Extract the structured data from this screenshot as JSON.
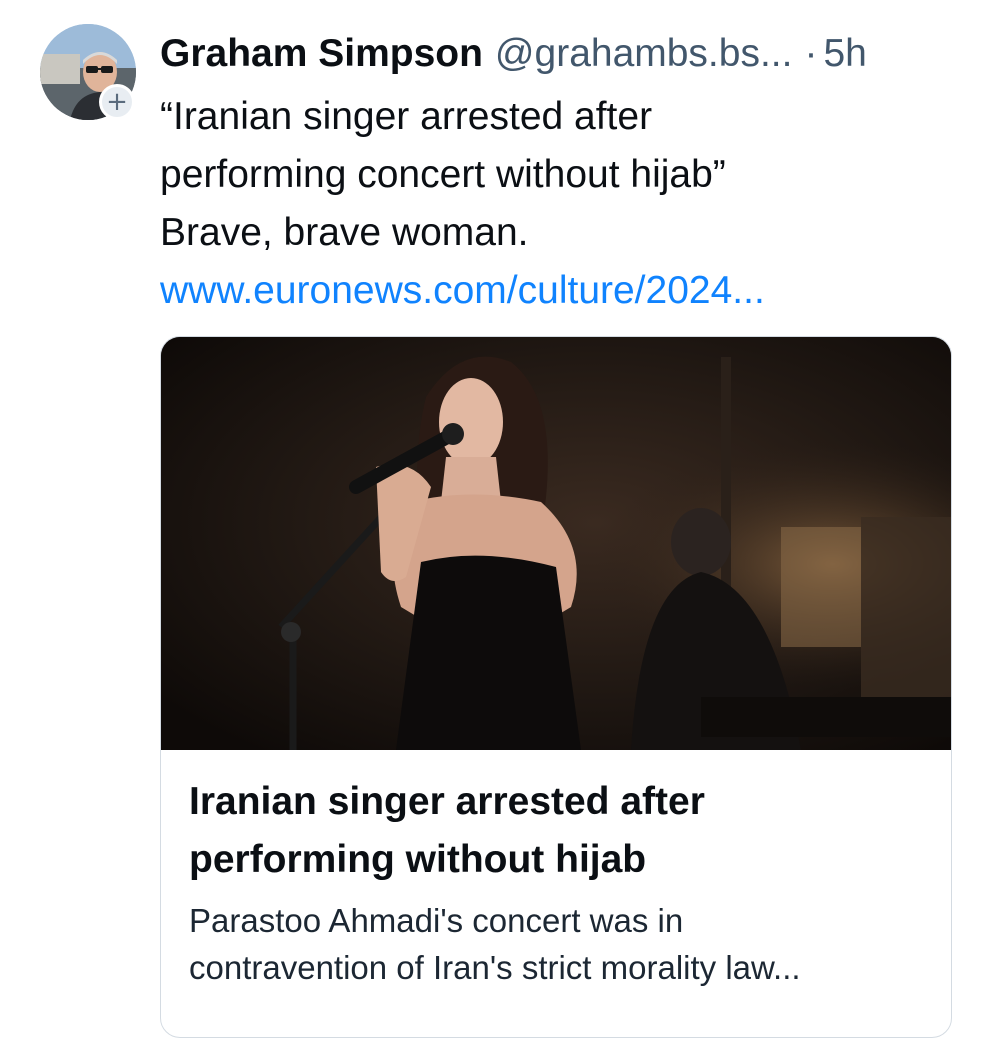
{
  "post": {
    "author": {
      "display_name": "Graham Simpson",
      "handle": "@grahambs.bs...",
      "avatar_icon": "user-avatar-photo",
      "follow_badge": "+"
    },
    "separator": "·",
    "timestamp": "5h",
    "text_lines": [
      "“Iranian singer arrested after",
      "performing concert without hijab”",
      "Brave, brave woman."
    ],
    "link_text": "www.euronews.com/culture/2024...",
    "card": {
      "image_icon": "singer-performing-photo",
      "title_lines": [
        "Iranian singer arrested after",
        "performing without hijab"
      ],
      "description_lines": [
        "Parastoo Ahmadi's concert was in",
        "contravention of Iran's strict morality law..."
      ]
    }
  },
  "colors": {
    "link": "#1083fe",
    "muted": "#42576c",
    "text": "#0b0f14",
    "card_border": "#d4dbe2"
  }
}
